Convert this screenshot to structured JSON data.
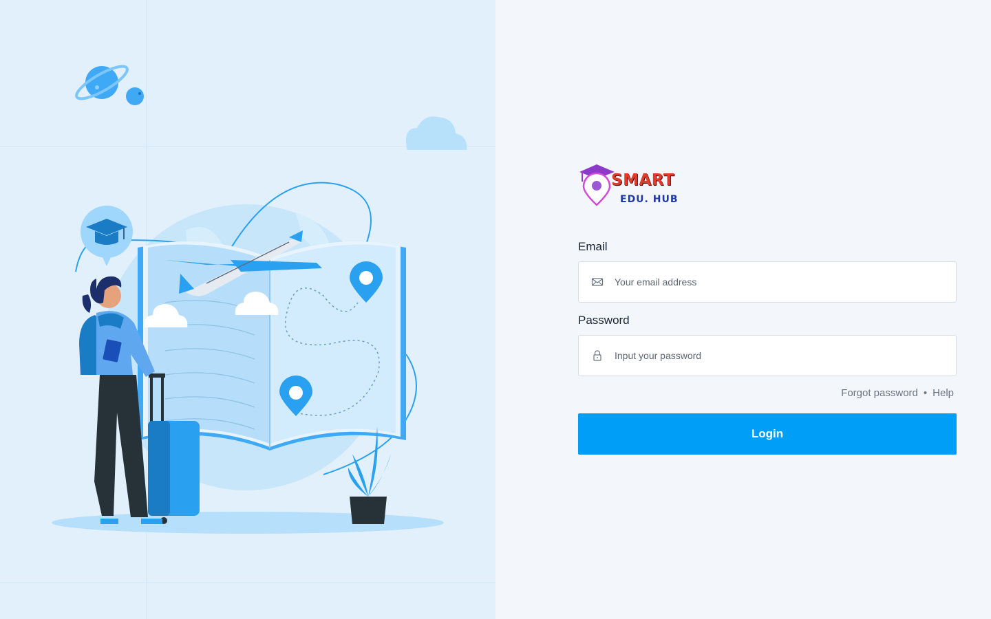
{
  "brand": {
    "name_line1": "SMART",
    "name_line2": "EDU. HUB"
  },
  "login_form": {
    "email_label": "Email",
    "email_placeholder": "Your email address",
    "password_label": "Password",
    "password_placeholder": "Input your password",
    "forgot_password_link": "Forgot password",
    "separator": "•",
    "help_link": "Help",
    "submit_label": "Login"
  },
  "colors": {
    "accent": "#009ef7",
    "left_panel_bg": "#e2f0fb",
    "right_panel_bg": "#f3f7fb",
    "brand_red": "#e23b2c",
    "brand_blue": "#1f3aa6",
    "brand_purple": "#8e3ac9"
  },
  "icons": {
    "email": "envelope-icon",
    "password": "lock-icon"
  }
}
